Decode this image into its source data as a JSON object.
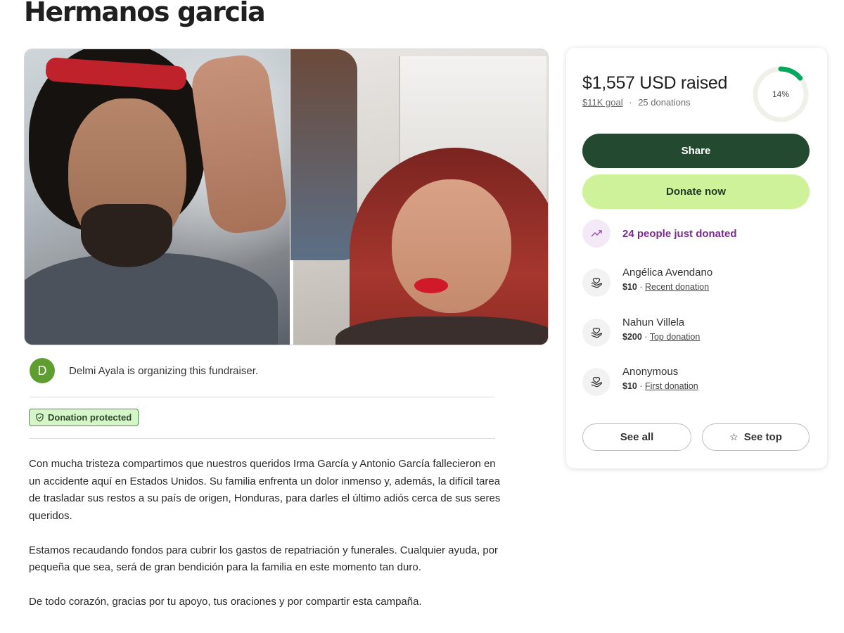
{
  "page": {
    "title": "Hermanos garcia"
  },
  "organizer": {
    "initial": "D",
    "text": "Delmi Ayala is organizing this fundraiser."
  },
  "badge": {
    "label": "Donation protected"
  },
  "story": {
    "paragraphs": [
      "Con mucha tristeza compartimos que nuestros queridos Irma García y Antonio García fallecieron en un accidente aquí en Estados Unidos. Su familia enfrenta un dolor inmenso y, además, la difícil tarea de trasladar sus restos a su país de origen, Honduras, para darles el último adiós cerca de sus seres queridos.",
      "Estamos recaudando fondos para cubrir los gastos de repatriación y funerales. Cualquier ayuda, por pequeña que sea, será de gran bendición para la familia en este momento tan duro.",
      "De todo corazón, gracias por tu apoyo, tus oraciones y por compartir esta campaña."
    ]
  },
  "donation_card": {
    "raised": "$1,557 USD raised",
    "goal": "$11K goal",
    "separator": "·",
    "donations": "25 donations",
    "progress_label": "14%",
    "progress_fraction": 0.14,
    "share_label": "Share",
    "donate_label": "Donate now",
    "trend_text": "24 people just donated",
    "donors": [
      {
        "name": "Angélica Avendano",
        "amount": "$10",
        "tag": "Recent donation"
      },
      {
        "name": "Nahun Villela",
        "amount": "$200",
        "tag": "Top donation"
      },
      {
        "name": "Anonymous",
        "amount": "$10",
        "tag": "First donation"
      }
    ],
    "see_all_label": "See all",
    "see_top_label": "See top"
  },
  "colors": {
    "share_bg": "#234a31",
    "donate_bg": "#cdf29a",
    "progress": "#02a95c",
    "trend_text": "#7b2c8d",
    "badge_bg": "#d6f5c9"
  },
  "icons": {
    "trend": "trending-up-icon",
    "donor": "heart-hand-icon",
    "badge": "shield-icon",
    "see_top": "star-icon"
  }
}
